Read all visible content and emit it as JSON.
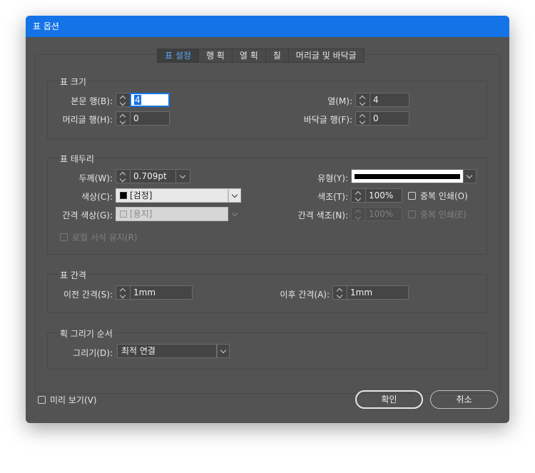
{
  "dialog": {
    "title": "표 옵션"
  },
  "tabs": [
    {
      "label": "표 설정"
    },
    {
      "label": "행 획"
    },
    {
      "label": "열 획"
    },
    {
      "label": "칠"
    },
    {
      "label": "머리글 및 바닥글"
    }
  ],
  "active_tab": 0,
  "table_size": {
    "title": "표 크기",
    "body_rows_label": "본문 행(B):",
    "body_rows_value": "4",
    "columns_label": "열(M):",
    "columns_value": "4",
    "header_rows_label": "머리글 행(H):",
    "header_rows_value": "0",
    "footer_rows_label": "바닥글 행(F):",
    "footer_rows_value": "0"
  },
  "table_border": {
    "title": "표 테두리",
    "weight_label": "두께(W):",
    "weight_value": "0.709pt",
    "type_label": "유형(Y):",
    "color_label": "색상(C):",
    "color_value": "[검정]",
    "tint_label": "색조(T):",
    "tint_value": "100%",
    "overprint_label": "중복 인쇄(O)",
    "gap_color_label": "간격 색상(G):",
    "gap_color_value": "[용지]",
    "gap_tint_label": "간격 색조(N):",
    "gap_tint_value": "100%",
    "gap_overprint_label": "중복 인쇄(E)",
    "preserve_local_label": "로컬 서식 유지(R)"
  },
  "table_spacing": {
    "title": "표 간격",
    "before_label": "이전 간격(S):",
    "before_value": "1mm",
    "after_label": "이후 간격(A):",
    "after_value": "1mm"
  },
  "stroke_order": {
    "title": "획 그리기 순서",
    "draw_label": "그리기(D):",
    "draw_value": "최적 연결"
  },
  "footer": {
    "preview_label": "미리 보기(V)",
    "ok_label": "확인",
    "cancel_label": "취소"
  },
  "colors": {
    "titlebar": "#1473e6",
    "dialog_bg": "#535353",
    "active_tab_text": "#5aa7f6"
  }
}
